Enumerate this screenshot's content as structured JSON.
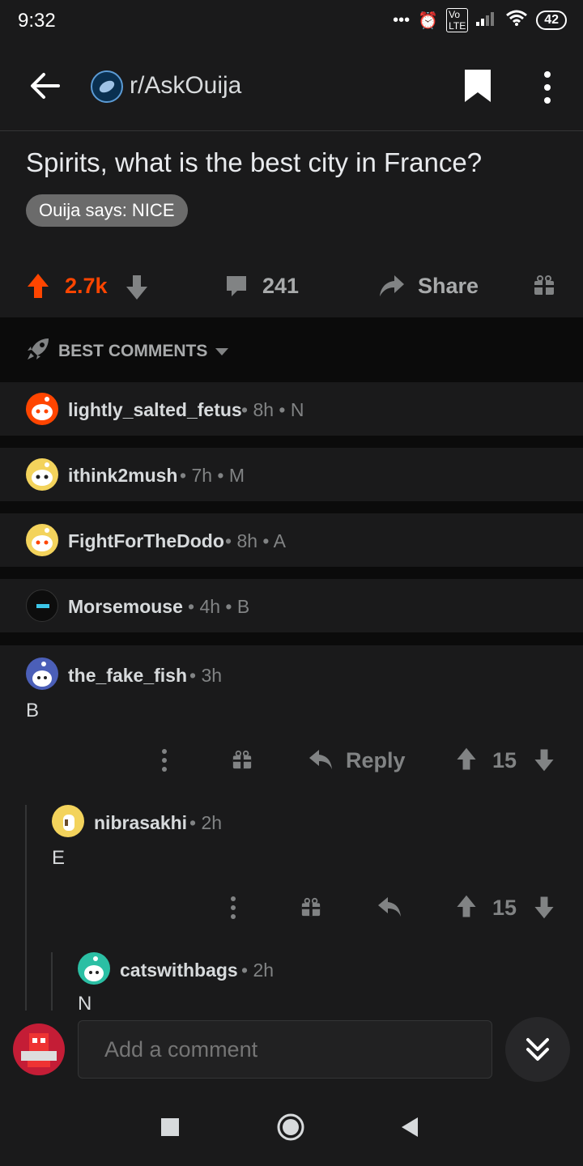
{
  "status_bar": {
    "time": "9:32",
    "battery": "42",
    "dots": "•••"
  },
  "header": {
    "subreddit": "r/AskOuija"
  },
  "post": {
    "title": "Spirits, what is the best city in France?",
    "flair": "Ouija says: NICE",
    "score": "2.7k",
    "comments": "241",
    "share_label": "Share"
  },
  "sort": {
    "label": "BEST COMMENTS"
  },
  "collapsed_comments": [
    {
      "user": "lightly_salted_fetus",
      "age": "8h",
      "letter": "N"
    },
    {
      "user": "ithink2mush",
      "age": "7h",
      "letter": "M"
    },
    {
      "user": "FightForTheDodo",
      "age": "8h",
      "letter": "A"
    },
    {
      "user": "Morsemouse",
      "age": "4h",
      "letter": "B"
    }
  ],
  "expanded_comments": [
    {
      "user": "the_fake_fish",
      "age": "3h",
      "body": "B",
      "reply_label": "Reply",
      "score": "15"
    },
    {
      "user": "nibrasakhi",
      "age": "2h",
      "body": "E",
      "score": "15"
    },
    {
      "user": "catswithbags",
      "age": "2h",
      "body": "N"
    }
  ],
  "composer": {
    "placeholder": "Add a comment"
  },
  "colors": {
    "accent": "#ff4500",
    "background": "#1a1a1b",
    "separator": "#0b0b0b"
  }
}
